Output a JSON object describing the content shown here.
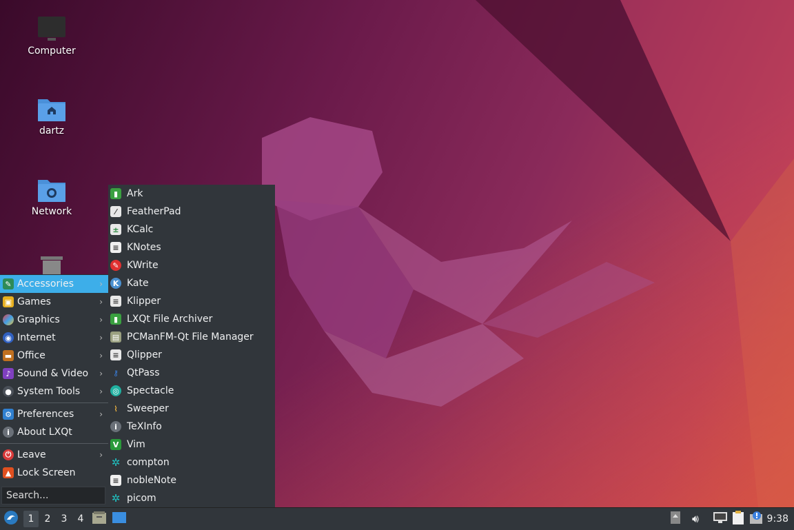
{
  "desktop": {
    "icons": [
      {
        "label": "Computer",
        "icon": "computer-icon"
      },
      {
        "label": "dartz",
        "icon": "home-folder-icon"
      },
      {
        "label": "Network",
        "icon": "network-folder-icon"
      },
      {
        "label": "",
        "icon": "trash-icon"
      }
    ]
  },
  "main_menu": {
    "items": [
      {
        "label": "Accessories",
        "icon": "accessories-icon",
        "has_submenu": true,
        "active": true
      },
      {
        "label": "Games",
        "icon": "games-icon",
        "has_submenu": true
      },
      {
        "label": "Graphics",
        "icon": "graphics-icon",
        "has_submenu": true
      },
      {
        "label": "Internet",
        "icon": "internet-icon",
        "has_submenu": true
      },
      {
        "label": "Office",
        "icon": "office-icon",
        "has_submenu": true
      },
      {
        "label": "Sound & Video",
        "icon": "sound-video-icon",
        "has_submenu": true
      },
      {
        "label": "System Tools",
        "icon": "system-tools-icon",
        "has_submenu": true
      },
      {
        "label": "Preferences",
        "icon": "preferences-icon",
        "has_submenu": true
      },
      {
        "label": "About LXQt",
        "icon": "info-icon",
        "has_submenu": false
      },
      {
        "label": "Leave",
        "icon": "power-icon",
        "has_submenu": true
      },
      {
        "label": "Lock Screen",
        "icon": "lock-icon",
        "has_submenu": false
      }
    ],
    "search_placeholder": "Search..."
  },
  "accessories_submenu": {
    "items": [
      {
        "label": "Ark",
        "icon": "ark-icon"
      },
      {
        "label": "FeatherPad",
        "icon": "featherpad-icon"
      },
      {
        "label": "KCalc",
        "icon": "kcalc-icon"
      },
      {
        "label": "KNotes",
        "icon": "knotes-icon"
      },
      {
        "label": "KWrite",
        "icon": "kwrite-icon"
      },
      {
        "label": "Kate",
        "icon": "kate-icon"
      },
      {
        "label": "Klipper",
        "icon": "klipper-icon"
      },
      {
        "label": "LXQt File Archiver",
        "icon": "archiver-icon"
      },
      {
        "label": "PCManFM-Qt File Manager",
        "icon": "file-manager-icon"
      },
      {
        "label": "Qlipper",
        "icon": "qlipper-icon"
      },
      {
        "label": "QtPass",
        "icon": "qtpass-icon"
      },
      {
        "label": "Spectacle",
        "icon": "spectacle-icon"
      },
      {
        "label": "Sweeper",
        "icon": "sweeper-icon"
      },
      {
        "label": "TeXInfo",
        "icon": "texinfo-icon"
      },
      {
        "label": "Vim",
        "icon": "vim-icon"
      },
      {
        "label": "compton",
        "icon": "compton-icon"
      },
      {
        "label": "nobleNote",
        "icon": "noblenote-icon"
      },
      {
        "label": "picom",
        "icon": "picom-icon"
      }
    ]
  },
  "taskbar": {
    "desktops": [
      "1",
      "2",
      "3",
      "4"
    ],
    "current_desktop": "1",
    "clock": "9:38",
    "tray_icons": [
      "removable-drive-icon",
      "volume-icon",
      "network-status-icon",
      "clipboard-icon",
      "update-notifier-icon"
    ]
  },
  "colors": {
    "panel": "#31363b",
    "highlight": "#3daee9"
  }
}
